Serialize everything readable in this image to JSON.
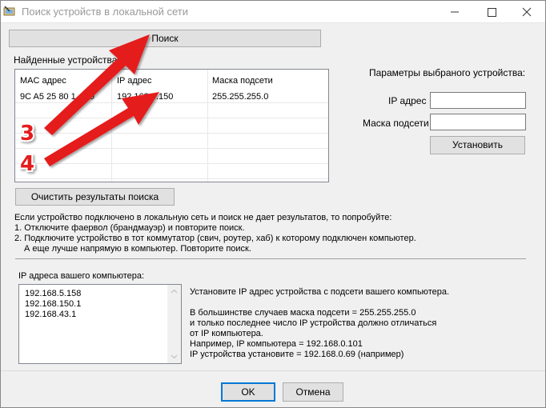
{
  "window": {
    "title": "Поиск устройств в локальной сети"
  },
  "search": {
    "button_label": "Поиск"
  },
  "found_devices": {
    "group_label": "Найденные устройства",
    "columns": [
      "MAC адрес",
      "IP адрес",
      "Маска подсети"
    ],
    "rows": [
      [
        "9C A5 25 80 1_ D9",
        "192.168.5.150",
        "255.255.255.0"
      ]
    ]
  },
  "clear_button_label": "Очистить результаты поиска",
  "device_params": {
    "heading": "Параметры выбраного устройства:",
    "ip_label": "IP адрес",
    "ip_value": "",
    "mask_label": "Маска подсети",
    "mask_value": "",
    "set_button_label": "Установить"
  },
  "instructions": {
    "line1": "Если устройство подключено в локальную сеть и поиск не дает результатов, то попробуйте:",
    "line2": "1. Отключите фаервол (брандмауэр) и повторите поиск.",
    "line3": "2. Подключите устройство в тот коммутатор (свич, роутер, хаб) к которому подключен компьютер.",
    "line4": "А еще лучше напрямую в компьютер. Повторите поиск."
  },
  "pc_ips": {
    "label": "IP адреса вашего компьютера:",
    "items": [
      "192.168.5.158",
      "192.168.150.1",
      "192.168.43.1"
    ]
  },
  "hint": {
    "line1": "Установите IP адрес устройства с подсети вашего компьютера.",
    "line2": "В большинстве случаев маска подсети = 255.255.255.0",
    "line3": "и только последнее число IP устройства должно отличаться",
    "line4": "от IP компьютера.",
    "line5": "Например, IP компьютера  = 192.168.0.101",
    "line6": "IP устройства  установите = 192.168.0.69  (например)"
  },
  "footer": {
    "ok_label": "OK",
    "cancel_label": "Отмена"
  },
  "annotations": {
    "step3": "3",
    "step4": "4",
    "arrow_color": "#e51a1a"
  }
}
